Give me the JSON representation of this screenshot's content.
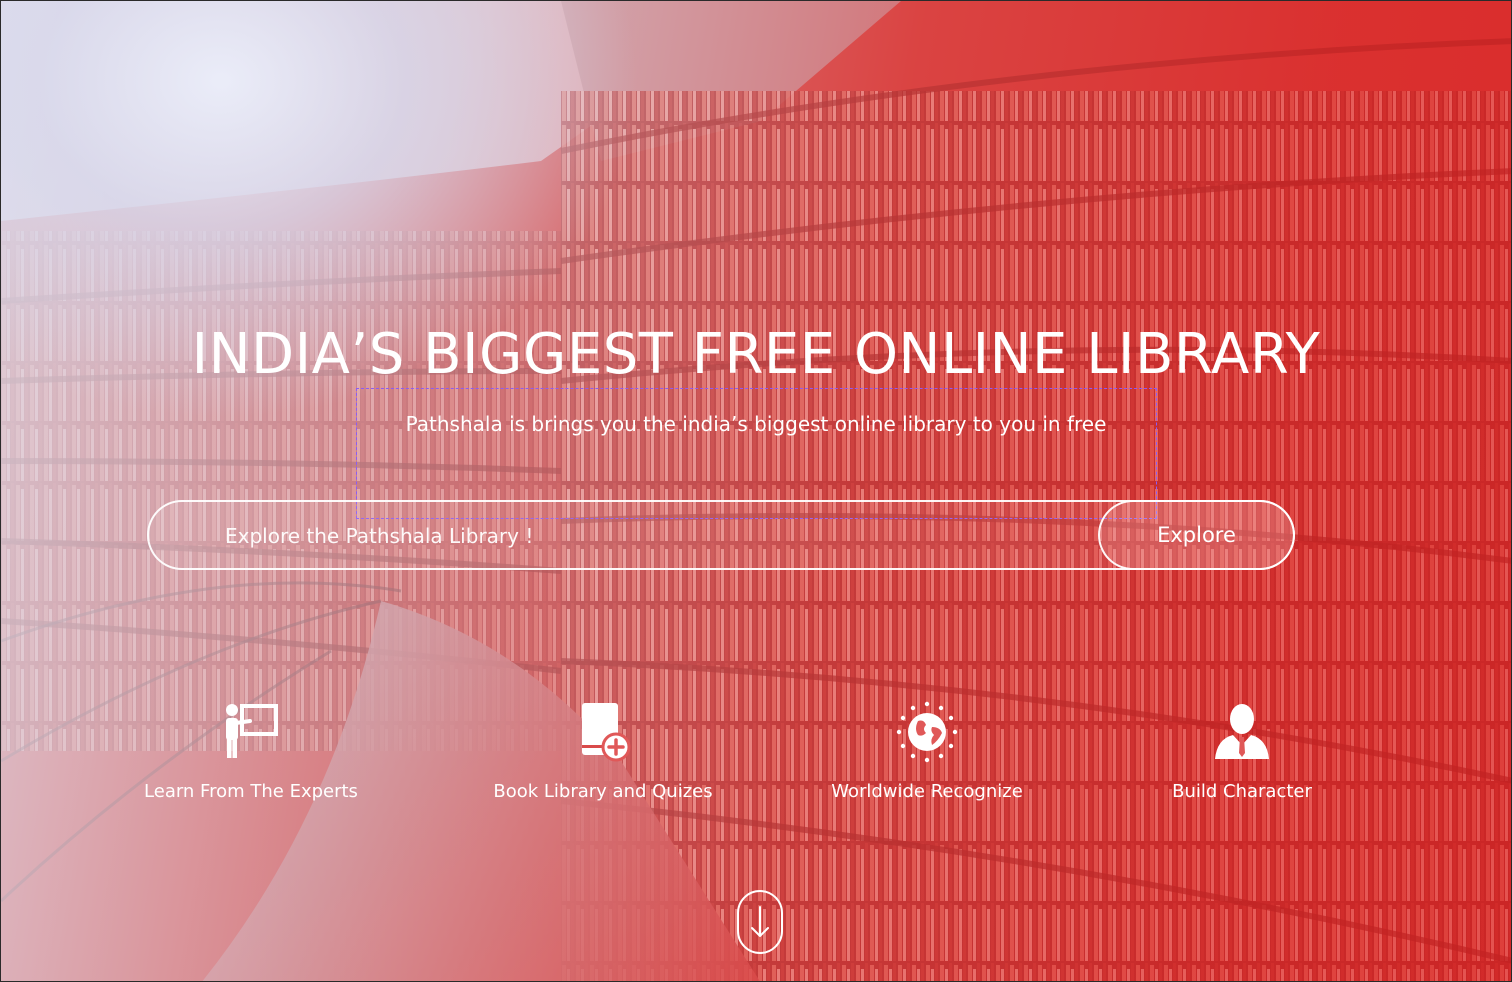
{
  "hero": {
    "title": "INDIA’S BIGGEST FREE ONLINE LIBRARY",
    "subtitle": "Pathshala is brings you the india’s biggest online library to you in free"
  },
  "search": {
    "placeholder": "Explore the Pathshala Library !",
    "button_label": "Explore"
  },
  "features": [
    {
      "label": "Learn From The Experts",
      "icon": "teacher-board-icon"
    },
    {
      "label": "Book Library and Quizes",
      "icon": "add-book-icon"
    },
    {
      "label": "Worldwide Recognize",
      "icon": "globe-icon"
    },
    {
      "label": "Build Character",
      "icon": "person-icon"
    }
  ],
  "scroll": {
    "icon": "arrow-down-icon"
  },
  "colors": {
    "accent_red": "#e53935",
    "text": "#ffffff",
    "selection_outline": "#8b5cf6"
  }
}
